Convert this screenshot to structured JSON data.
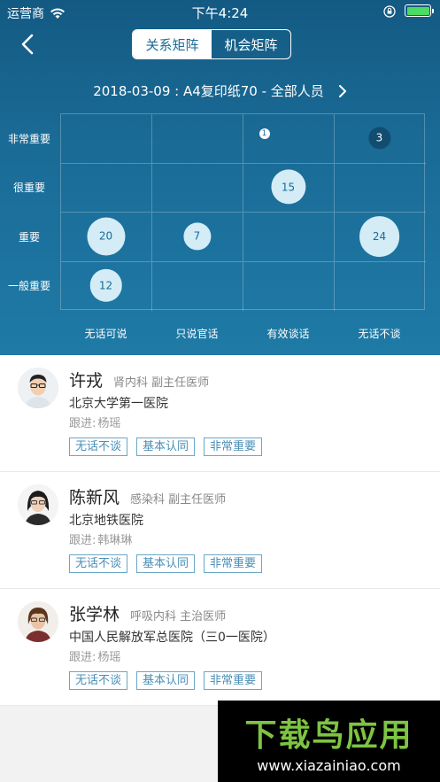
{
  "status_bar": {
    "carrier": "运营商",
    "time": "下午4:24",
    "battery_percent": 100
  },
  "nav": {
    "tabs": [
      {
        "label": "关系矩阵",
        "active": true
      },
      {
        "label": "机会矩阵",
        "active": false
      }
    ]
  },
  "subtitle": "2018-03-09 : A4复印纸70 - 全部人员",
  "matrix": {
    "y_labels": [
      "非常重要",
      "很重要",
      "重要",
      "一般重要"
    ],
    "x_labels": [
      "无话可说",
      "只说官话",
      "有效谈话",
      "无话不谈"
    ],
    "bubbles": [
      {
        "label": "1",
        "row": 0,
        "col": 2,
        "count": 1
      },
      {
        "label": "3",
        "row": 0,
        "col": 3,
        "count": 3
      },
      {
        "label": "15",
        "row": 1,
        "col": 2,
        "count": 15
      },
      {
        "label": "20",
        "row": 2,
        "col": 0,
        "count": 20
      },
      {
        "label": "7",
        "row": 2,
        "col": 1,
        "count": 7
      },
      {
        "label": "24",
        "row": 2,
        "col": 3,
        "count": 24
      },
      {
        "label": "12",
        "row": 3,
        "col": 0,
        "count": 12
      }
    ]
  },
  "contacts": [
    {
      "name": "许戎",
      "dept": "肾内科 副主任医师",
      "hospital": "北京大学第一医院",
      "follow_label": "跟进:",
      "follow_name": "杨瑶",
      "tags": [
        "无话不谈",
        "基本认同",
        "非常重要"
      ]
    },
    {
      "name": "陈新风",
      "dept": "感染科 副主任医师",
      "hospital": "北京地铁医院",
      "follow_label": "跟进:",
      "follow_name": "韩琳琳",
      "tags": [
        "无话不谈",
        "基本认同",
        "非常重要"
      ]
    },
    {
      "name": "张学林",
      "dept": "呼吸内科 主治医师",
      "hospital": "中国人民解放军总医院（三0一医院）",
      "follow_label": "跟进:",
      "follow_name": "杨瑶",
      "tags": [
        "无话不谈",
        "基本认同",
        "非常重要"
      ]
    }
  ],
  "watermark": {
    "title": "下载鸟应用",
    "url": "www.xiazainiao.com"
  },
  "colors": {
    "header": "#1a6b96",
    "bubble": "#d4ecf6",
    "bubble_dark": "#114d70",
    "tag": "#4a8fb5",
    "battery": "#4cd964"
  }
}
